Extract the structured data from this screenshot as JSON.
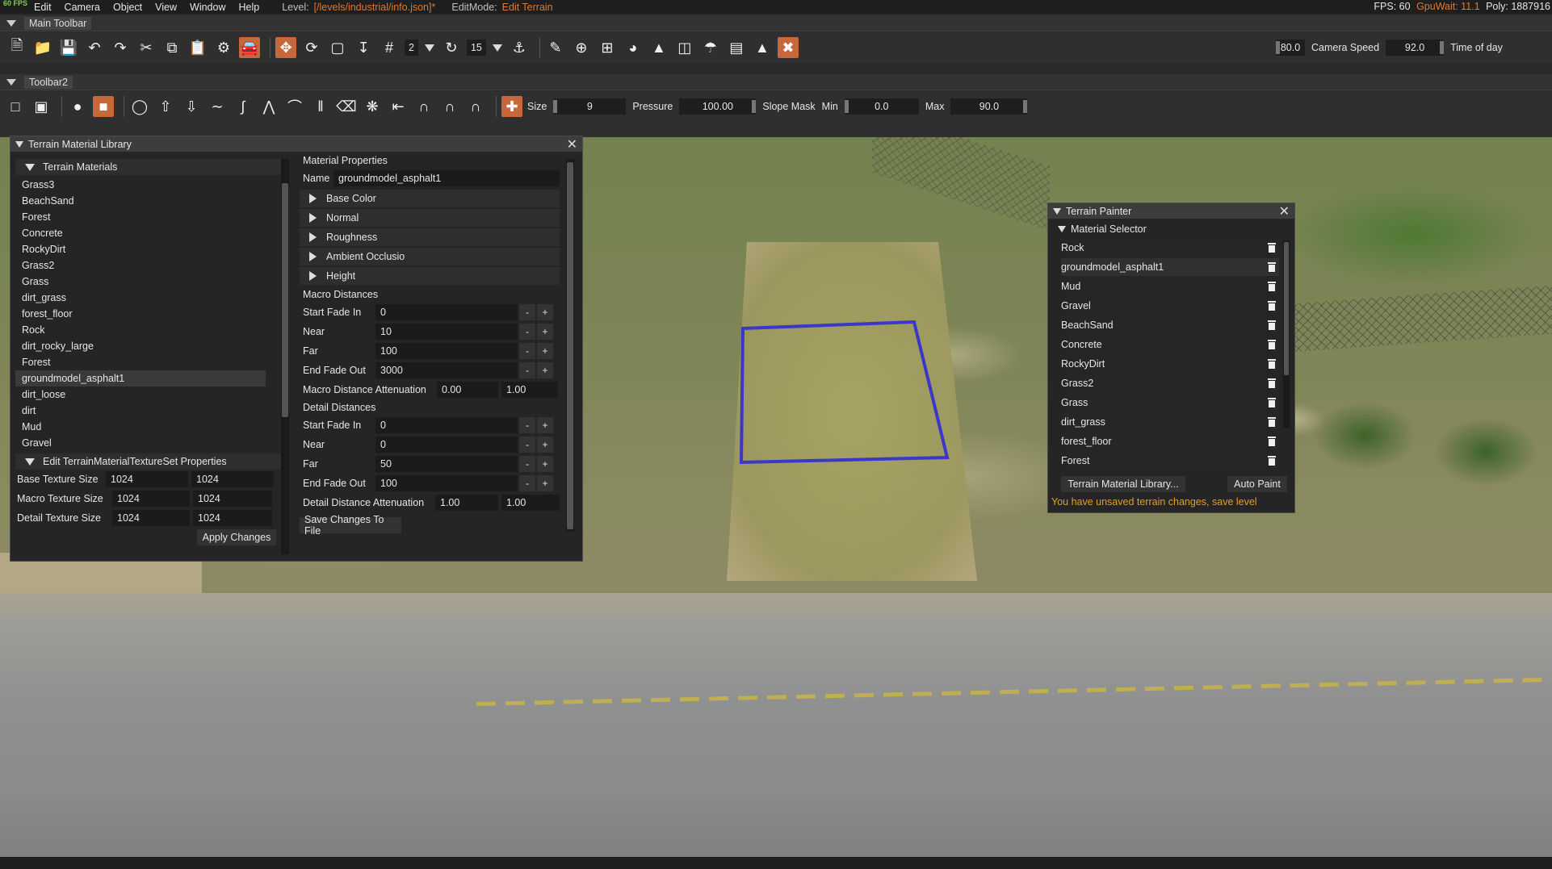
{
  "menubar": {
    "fps_badge": "60 FPS",
    "items": [
      "Edit",
      "Camera",
      "Object",
      "View",
      "Window",
      "Help"
    ],
    "level_label": "Level:",
    "level_path": "[/levels/industrial/info.json]*",
    "editmode_label": "EditMode:",
    "editmode_value": "Edit Terrain",
    "stats_fps": "FPS: 60",
    "stats_gpu": "GpuWait: 11.1",
    "stats_poly": "Poly: 1887916"
  },
  "main_toolbar": {
    "title": "Main Toolbar",
    "snap_value": "2",
    "rotate_snap_value": "15",
    "fov_value": "80.0",
    "camera_speed_label": "Camera Speed",
    "camera_speed_value": "92.0",
    "time_of_day_label": "Time of day"
  },
  "toolbar2": {
    "title": "Toolbar2",
    "size_label": "Size",
    "size_value": "9",
    "pressure_label": "Pressure",
    "pressure_value": "100.00",
    "slope_mask_label": "Slope Mask",
    "min_label": "Min",
    "min_value": "0.0",
    "max_label": "Max",
    "max_value": "90.0"
  },
  "library": {
    "title": "Terrain Material Library",
    "materials_header": "Terrain Materials",
    "materials": [
      "Grass3",
      "BeachSand",
      "Forest",
      "Concrete",
      "RockyDirt",
      "Grass2",
      "Grass",
      "dirt_grass",
      "forest_floor",
      "Rock",
      "dirt_rocky_large",
      "Forest",
      "groundmodel_asphalt1",
      "dirt_loose",
      "dirt",
      "Mud",
      "Gravel"
    ],
    "selected_index": 12,
    "texset_header": "Edit TerrainMaterialTextureSet Properties",
    "base_texture_label": "Base Texture Size",
    "base_texture_w": "1024",
    "base_texture_h": "1024",
    "macro_texture_label": "Macro Texture Size",
    "macro_texture_w": "1024",
    "macro_texture_h": "1024",
    "detail_texture_label": "Detail Texture Size",
    "detail_texture_w": "1024",
    "detail_texture_h": "1024",
    "apply_label": "Apply Changes"
  },
  "properties": {
    "header": "Material Properties",
    "name_label": "Name",
    "name_value": "groundmodel_asphalt1",
    "sections": [
      "Base Color",
      "Normal",
      "Roughness",
      "Ambient Occlusio",
      "Height"
    ],
    "macro_header": "Macro Distances",
    "macro_rows": [
      {
        "label": "Start Fade In",
        "value": "0"
      },
      {
        "label": "Near",
        "value": "10"
      },
      {
        "label": "Far",
        "value": "100"
      },
      {
        "label": "End Fade Out",
        "value": "3000"
      }
    ],
    "macro_atten_label": "Macro Distance Attenuation",
    "macro_atten_a": "0.00",
    "macro_atten_b": "1.00",
    "detail_header": "Detail Distances",
    "detail_rows": [
      {
        "label": "Start Fade In",
        "value": "0"
      },
      {
        "label": "Near",
        "value": "0"
      },
      {
        "label": "Far",
        "value": "50"
      },
      {
        "label": "End Fade Out",
        "value": "100"
      }
    ],
    "detail_atten_label": "Detail Distance Attenuation",
    "detail_atten_a": "1.00",
    "detail_atten_b": "1.00",
    "minus": "-",
    "plus": "+",
    "save_label": "Save Changes To File"
  },
  "painter": {
    "title": "Terrain Painter",
    "selector_header": "Material Selector",
    "materials": [
      "Rock",
      "groundmodel_asphalt1",
      "Mud",
      "Gravel",
      "BeachSand",
      "Concrete",
      "RockyDirt",
      "Grass2",
      "Grass",
      "dirt_grass",
      "forest_floor",
      "Forest"
    ],
    "selected_index": 1,
    "library_button": "Terrain Material Library...",
    "auto_paint_button": "Auto Paint",
    "warning": "You have unsaved terrain changes, save level"
  },
  "colors": {
    "accent": "#e07a2e",
    "active_tool": "#c8673a",
    "warning": "#e0a020",
    "brush": "#3b37c9"
  }
}
